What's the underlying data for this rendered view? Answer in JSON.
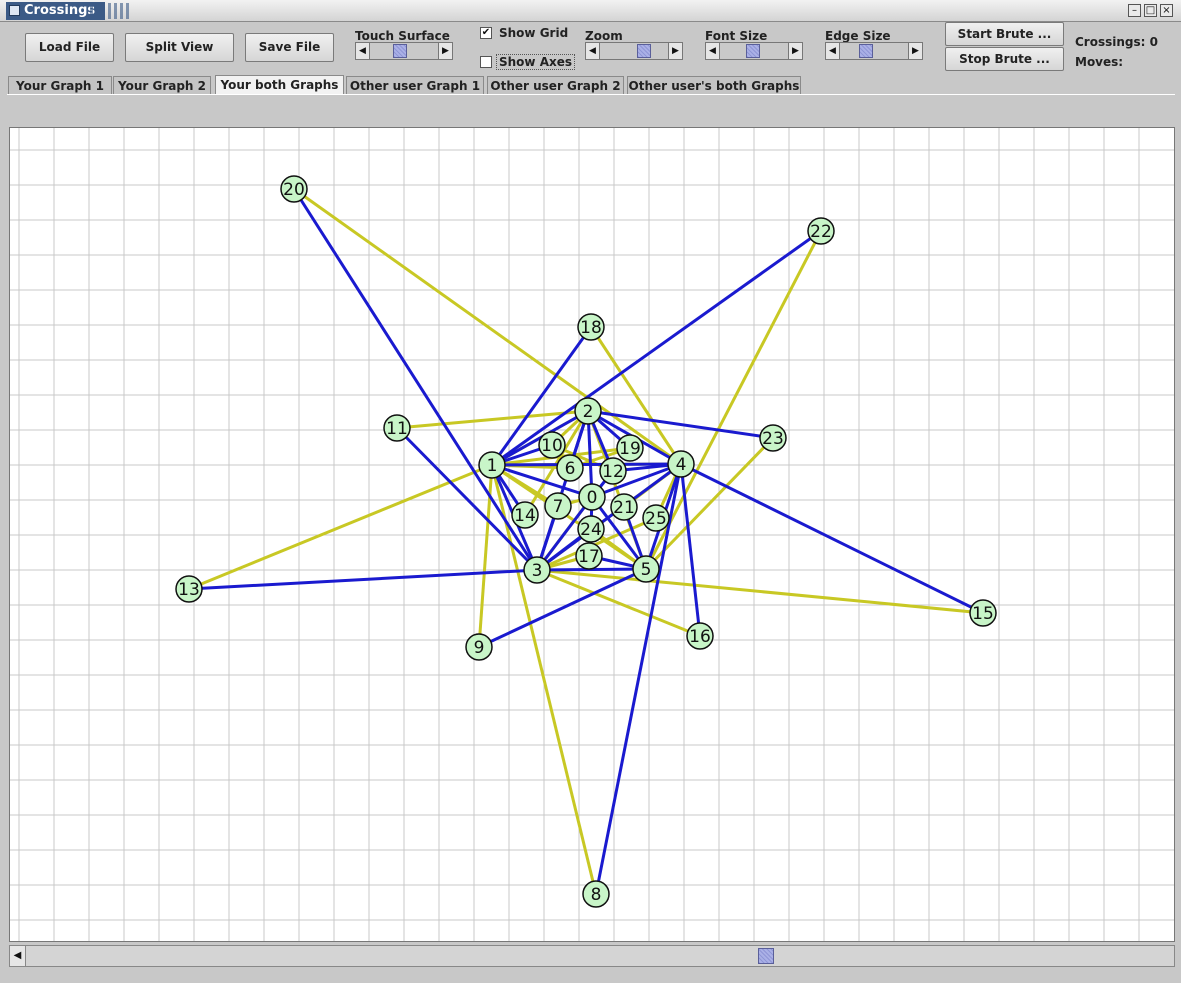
{
  "window": {
    "title": "Crossings"
  },
  "toolbar": {
    "load_label": "Load File",
    "split_label": "Split View",
    "save_label": "Save File",
    "touch_surface_label": "Touch Surface",
    "show_grid_label": "Show Grid",
    "show_grid_checked": true,
    "show_axes_label": "Show Axes",
    "show_axes_checked": false,
    "zoom_label": "Zoom",
    "font_size_label": "Font Size",
    "edge_size_label": "Edge Size",
    "start_brute_label": "Start Brute ...",
    "stop_brute_label": "Stop Brute ...",
    "crossings_label": "Crossings: 0",
    "moves_label": "Moves:"
  },
  "tabs": [
    {
      "label": "Your Graph 1",
      "active": false
    },
    {
      "label": "Your Graph 2",
      "active": false
    },
    {
      "label": "Your both Graphs",
      "active": true
    },
    {
      "label": "Other user Graph 1",
      "active": false
    },
    {
      "label": "Other user Graph 2",
      "active": false
    },
    {
      "label": "Other user's both Graphs",
      "active": false
    }
  ],
  "colors": {
    "graph1_edge": "#1a1acf",
    "graph2_edge": "#c8c824",
    "node_fill": "#c8f5c8",
    "grid": "#c8c8c8"
  },
  "graph": {
    "nodes": [
      "0",
      "1",
      "2",
      "3",
      "4",
      "5",
      "6",
      "7",
      "8",
      "9",
      "10",
      "11",
      "12",
      "13",
      "14",
      "15",
      "16",
      "17",
      "18",
      "19",
      "20",
      "21",
      "22",
      "23",
      "24",
      "25"
    ],
    "blue_edges": [
      [
        "20",
        "3"
      ],
      [
        "22",
        "1"
      ],
      [
        "18",
        "1"
      ],
      [
        "11",
        "3"
      ],
      [
        "13",
        "3"
      ],
      [
        "15",
        "4"
      ],
      [
        "9",
        "5"
      ],
      [
        "8",
        "4"
      ],
      [
        "16",
        "4"
      ],
      [
        "1",
        "2"
      ],
      [
        "1",
        "10"
      ],
      [
        "1",
        "14"
      ],
      [
        "1",
        "3"
      ],
      [
        "1",
        "4"
      ],
      [
        "1",
        "0"
      ],
      [
        "2",
        "4"
      ],
      [
        "2",
        "23"
      ],
      [
        "2",
        "6"
      ],
      [
        "2",
        "12"
      ],
      [
        "2",
        "19"
      ],
      [
        "2",
        "3"
      ],
      [
        "2",
        "0"
      ],
      [
        "4",
        "12"
      ],
      [
        "4",
        "5"
      ],
      [
        "4",
        "3"
      ],
      [
        "4",
        "0"
      ],
      [
        "3",
        "5"
      ],
      [
        "3",
        "7"
      ],
      [
        "3",
        "24"
      ],
      [
        "3",
        "0"
      ],
      [
        "5",
        "17"
      ],
      [
        "5",
        "21"
      ],
      [
        "5",
        "0"
      ],
      [
        "0",
        "12"
      ],
      [
        "0",
        "24"
      ]
    ],
    "yellow_edges": [
      [
        "20",
        "4"
      ],
      [
        "22",
        "5"
      ],
      [
        "18",
        "4"
      ],
      [
        "11",
        "2"
      ],
      [
        "13",
        "1"
      ],
      [
        "15",
        "3"
      ],
      [
        "9",
        "1"
      ],
      [
        "8",
        "1"
      ],
      [
        "16",
        "3"
      ],
      [
        "23",
        "5"
      ],
      [
        "1",
        "6"
      ],
      [
        "1",
        "7"
      ],
      [
        "1",
        "19"
      ],
      [
        "1",
        "4"
      ],
      [
        "2",
        "10"
      ],
      [
        "2",
        "5"
      ],
      [
        "2",
        "14"
      ],
      [
        "2",
        "1"
      ],
      [
        "3",
        "25"
      ],
      [
        "3",
        "17"
      ],
      [
        "3",
        "0"
      ],
      [
        "4",
        "21"
      ],
      [
        "4",
        "25"
      ],
      [
        "4",
        "3"
      ],
      [
        "5",
        "24"
      ],
      [
        "5",
        "1"
      ],
      [
        "7",
        "0"
      ],
      [
        "10",
        "12"
      ],
      [
        "6",
        "19"
      ]
    ]
  }
}
